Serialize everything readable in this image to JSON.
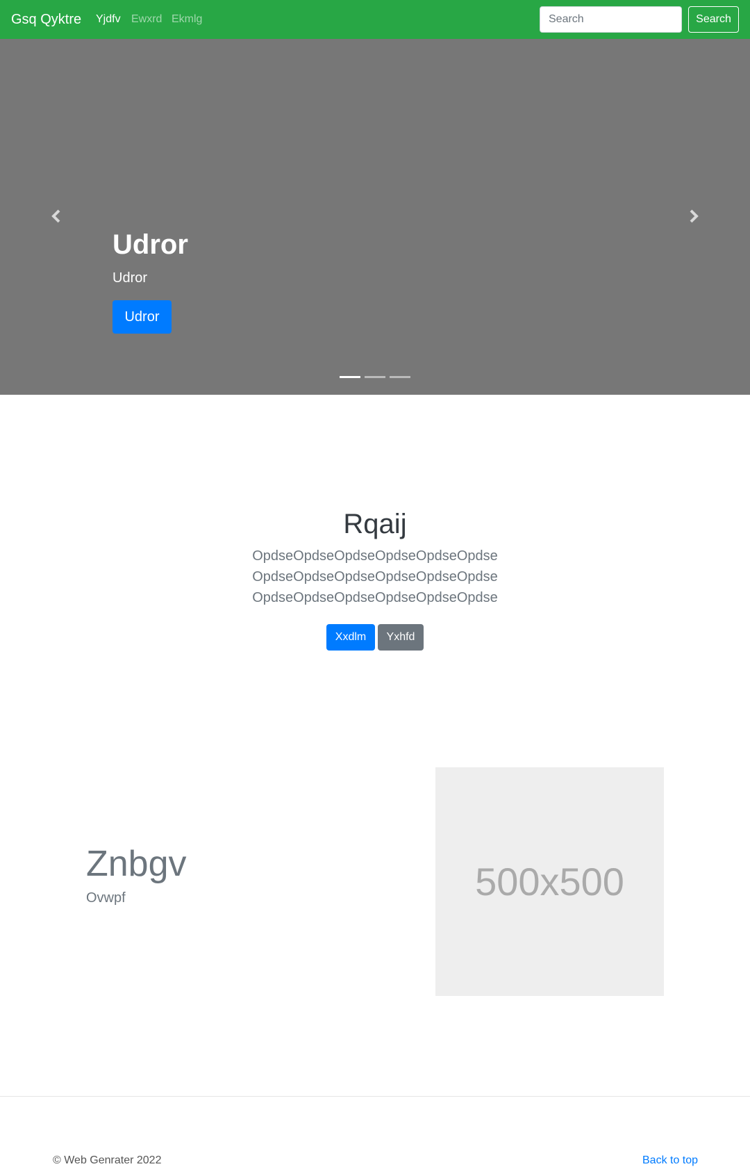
{
  "navbar": {
    "brand": "Gsq Qyktre",
    "links": [
      {
        "label": "Yjdfv",
        "active": true
      },
      {
        "label": "Ewxrd",
        "active": false
      },
      {
        "label": "Ekmlg",
        "active": false
      }
    ],
    "search_placeholder": "Search",
    "search_button": "Search",
    "color": "#28a745"
  },
  "carousel": {
    "title": "Udror",
    "subtitle": "Udror",
    "button_label": "Udror",
    "background": "#777777",
    "prev_icon": "chevron-left-icon",
    "next_icon": "chevron-right-icon",
    "slide_count": 3,
    "active_slide": 1
  },
  "intro": {
    "title": "Rqaij",
    "lead_lines": [
      "OpdseOpdseOpdseOpdseOpdseOpdse",
      "OpdseOpdseOpdseOpdseOpdseOpdse",
      "OpdseOpdseOpdseOpdseOpdseOpdse"
    ],
    "primary_button": "Xxdlm",
    "secondary_button": "Yxhfd"
  },
  "feature": {
    "heading": "Znbgv",
    "subheading": "Ovwpf",
    "image_label": "500x500"
  },
  "footer": {
    "copyright": "© Web Genrater 2022",
    "back_to_top": "Back to top"
  }
}
